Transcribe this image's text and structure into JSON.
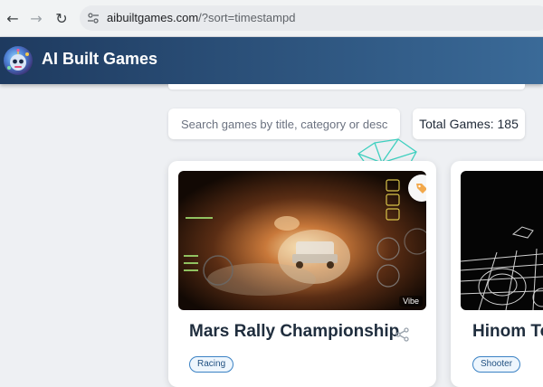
{
  "browser": {
    "url_domain": "aibuiltgames.com",
    "url_path": "/?sort=timestampd"
  },
  "header": {
    "title": "AI Built Games"
  },
  "search": {
    "placeholder": "Search games by title, category or descriptic"
  },
  "stats": {
    "total_label": "Total Games: 185"
  },
  "games": [
    {
      "title": "Mars Rally Championship",
      "category": "Racing",
      "badge": "Vibe"
    },
    {
      "title": "Hinom To",
      "category": "Shooter"
    }
  ],
  "colors": {
    "header_start": "#1e3a5f",
    "header_end": "#3a6a98",
    "tag_border": "#3b82c4",
    "fav_icon": "#f2a84b"
  },
  "icons": [
    "back-arrow-icon",
    "forward-arrow-icon",
    "reload-icon",
    "site-settings-icon",
    "share-icon",
    "tag-icon"
  ]
}
